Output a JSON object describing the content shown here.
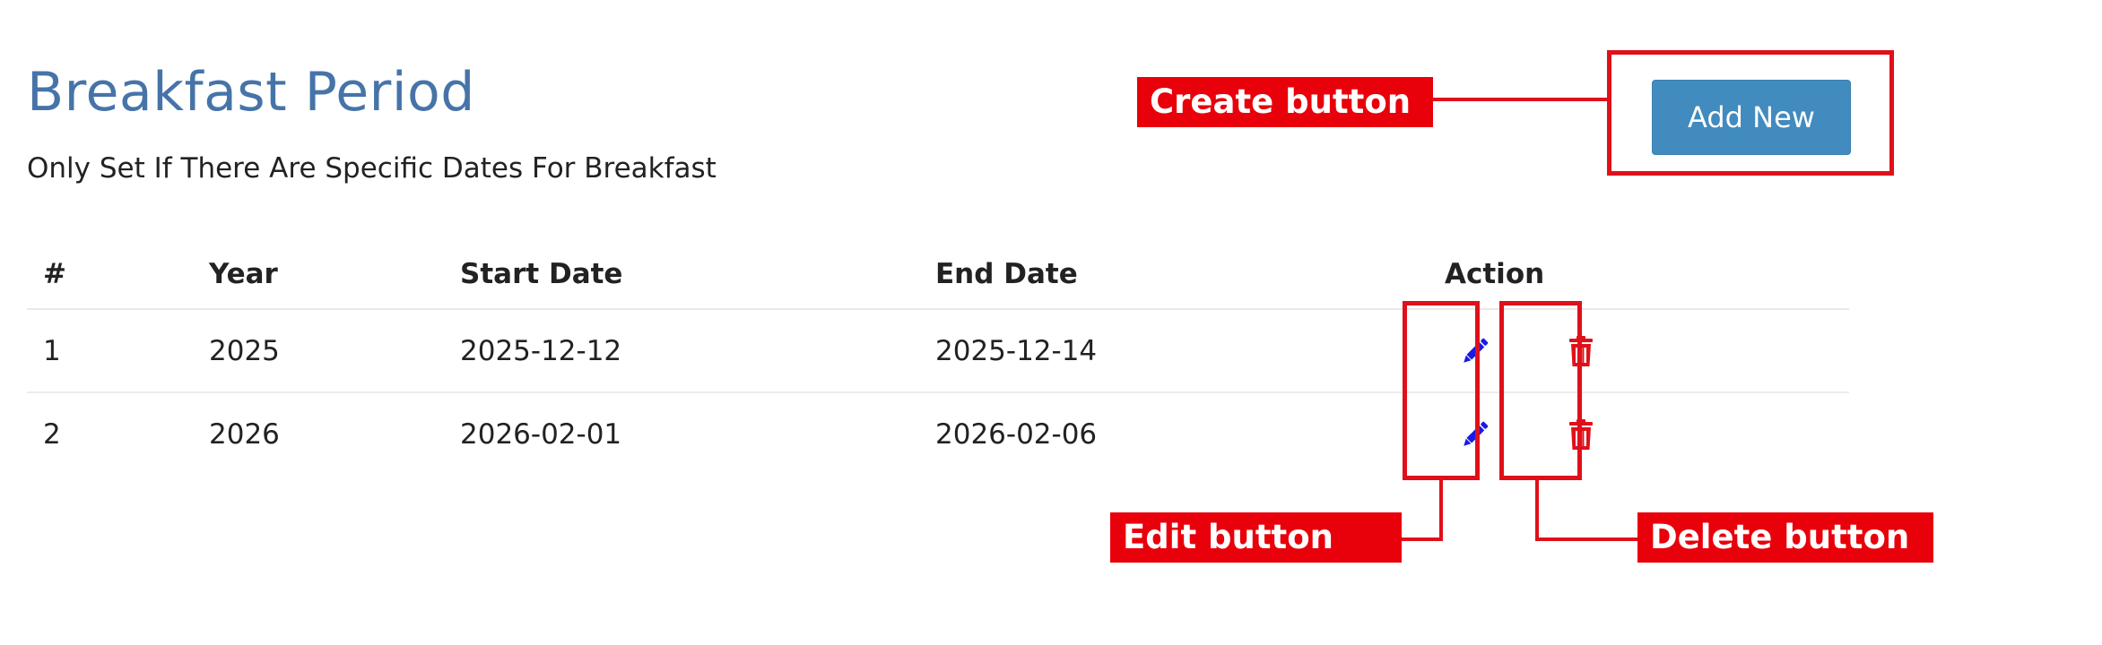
{
  "header": {
    "title": "Breakfast Period",
    "subtitle": "Only Set If There Are Specific Dates For Breakfast"
  },
  "toolbar": {
    "add_new_label": "Add New"
  },
  "table": {
    "columns": [
      "#",
      "Year",
      "Start Date",
      "End Date",
      "Action"
    ],
    "rows": [
      {
        "num": "1",
        "year": "2025",
        "start": "2025-12-12",
        "end": "2025-12-14"
      },
      {
        "num": "2",
        "year": "2026",
        "start": "2026-02-01",
        "end": "2026-02-06"
      }
    ]
  },
  "annotations": {
    "create": "Create button",
    "edit": "Edit button",
    "delete": "Delete button"
  },
  "icons": {
    "edit": "pencil-icon",
    "delete": "trash-icon"
  },
  "colors": {
    "title": "#4674a8",
    "primary_button": "#418bbf",
    "edit_icon": "#1a1ae6",
    "delete_icon": "#e0101a",
    "annotation": "#e8000b"
  }
}
